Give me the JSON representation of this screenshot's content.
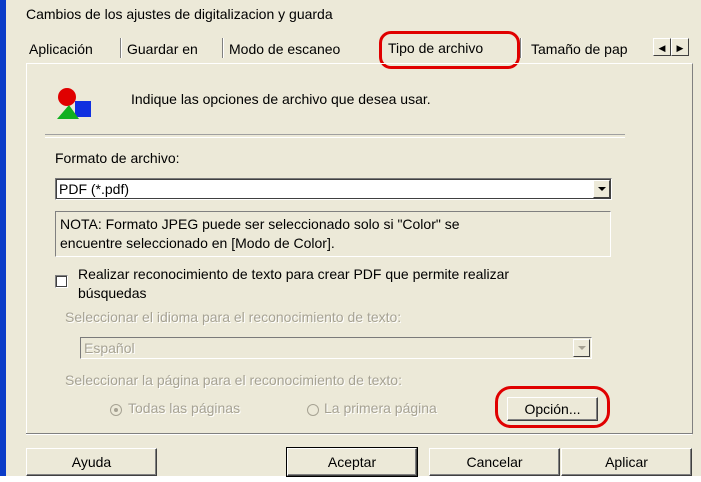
{
  "window": {
    "title": "Cambios de los ajustes de digitalizacion y guarda"
  },
  "tabs": [
    {
      "label": "Aplicación"
    },
    {
      "label": "Guardar en"
    },
    {
      "label": "Modo de escaneo"
    },
    {
      "label": "Tipo de archivo",
      "active": true
    },
    {
      "label": "Tamaño de pap"
    }
  ],
  "header": {
    "text": "Indique las opciones de archivo que desea usar."
  },
  "format": {
    "label": "Formato de archivo:",
    "value": "PDF (*.pdf)"
  },
  "note": {
    "line1": "NOTA: Formato JPEG puede ser seleccionado solo si \"Color\" se",
    "line2": "encuentre seleccionado en [Modo de Color]."
  },
  "ocr": {
    "checkbox_line1": "Realizar reconocimiento de texto para crear PDF que permite realizar",
    "checkbox_line2": "búsquedas",
    "checked": false,
    "language_label": "Seleccionar el idioma para el reconocimiento de texto:",
    "language_value": "Español",
    "page_label": "Seleccionar la página para el reconocimiento de texto:",
    "radio_all": "Todas las páginas",
    "radio_first": "La primera página",
    "option_button": "Opción..."
  },
  "buttons": {
    "help": "Ayuda",
    "ok": "Aceptar",
    "cancel": "Cancelar",
    "apply": "Aplicar"
  },
  "colors": {
    "dialog_bg": "#ece9d8",
    "highlight_red": "#e00000",
    "disabled_text": "#a6a293"
  },
  "icons": {
    "tab_scroll_left": "arrow-left-icon",
    "tab_scroll_right": "arrow-right-icon",
    "header_icon": "shapes-icon"
  }
}
